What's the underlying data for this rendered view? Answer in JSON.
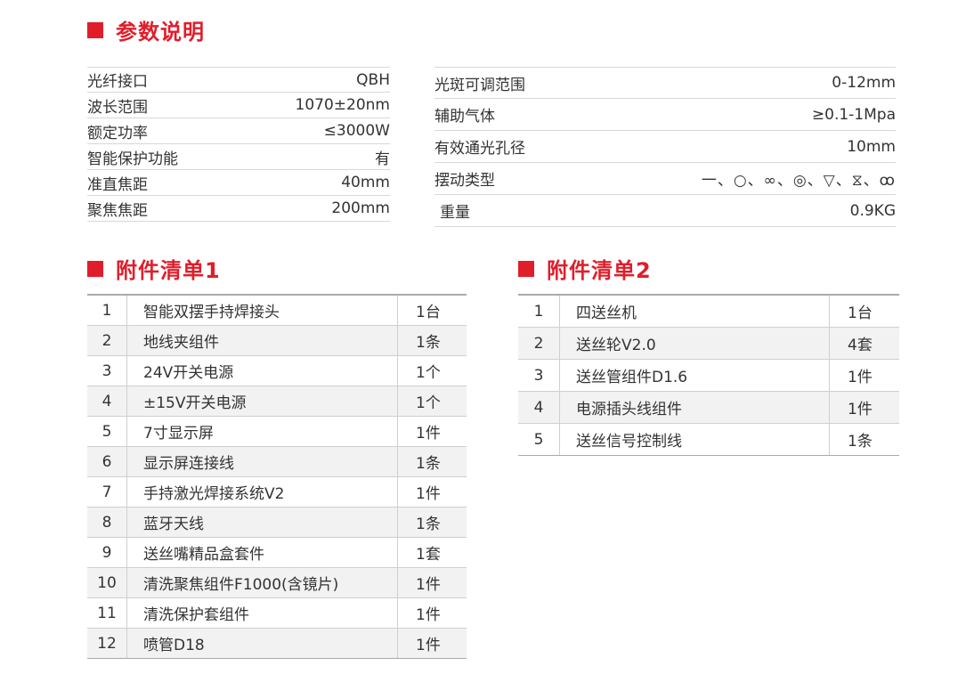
{
  "params": {
    "title": "参数说明",
    "left": [
      {
        "label": "光纤接口",
        "value": "QBH"
      },
      {
        "label": "波长范围",
        "value": "1070±20nm"
      },
      {
        "label": "额定功率",
        "value": "≤3000W"
      },
      {
        "label": "智能保护功能",
        "value": "有"
      },
      {
        "label": "准直焦距",
        "value": "40mm"
      },
      {
        "label": "聚焦焦距",
        "value": "200mm"
      }
    ],
    "right": [
      {
        "label": "光斑可调范围",
        "value": "0-12mm"
      },
      {
        "label": "辅助气体",
        "value": "≥0.1-1Mpa"
      },
      {
        "label": "有效通光孔径",
        "value": "10mm"
      },
      {
        "label": "摆动类型",
        "value": "一、○、∞、◎、▽、⧖、ꝏ"
      },
      {
        "label": "重量",
        "value": "0.9KG"
      }
    ]
  },
  "accessories1": {
    "title": "附件清单1",
    "rows": [
      {
        "no": "1",
        "name": "智能双摆手持焊接头",
        "qty": "1台"
      },
      {
        "no": "2",
        "name": "地线夹组件",
        "qty": "1条"
      },
      {
        "no": "3",
        "name": "24V开关电源",
        "qty": "1个"
      },
      {
        "no": "4",
        "name": "±15V开关电源",
        "qty": "1个"
      },
      {
        "no": "5",
        "name": "7寸显示屏",
        "qty": "1件"
      },
      {
        "no": "6",
        "name": "显示屏连接线",
        "qty": "1条"
      },
      {
        "no": "7",
        "name": "手持激光焊接系统V2",
        "qty": "1件"
      },
      {
        "no": "8",
        "name": "蓝牙天线",
        "qty": "1条"
      },
      {
        "no": "9",
        "name": "送丝嘴精品盒套件",
        "qty": "1套"
      },
      {
        "no": "10",
        "name": "清洗聚焦组件F1000(含镜片)",
        "qty": "1件"
      },
      {
        "no": "11",
        "name": "清洗保护套组件",
        "qty": "1件"
      },
      {
        "no": "12",
        "name": "喷管D18",
        "qty": "1件"
      }
    ]
  },
  "accessories2": {
    "title": "附件清单2",
    "rows": [
      {
        "no": "1",
        "name": "四送丝机",
        "qty": "1台"
      },
      {
        "no": "2",
        "name": "送丝轮V2.0",
        "qty": "4套"
      },
      {
        "no": "3",
        "name": "送丝管组件D1.6",
        "qty": "1件"
      },
      {
        "no": "4",
        "name": "电源插头线组件",
        "qty": "1件"
      },
      {
        "no": "5",
        "name": "送丝信号控制线",
        "qty": "1条"
      }
    ]
  },
  "colors": {
    "accent": "#e01e2b",
    "alt_row": "#f2f2f2"
  }
}
